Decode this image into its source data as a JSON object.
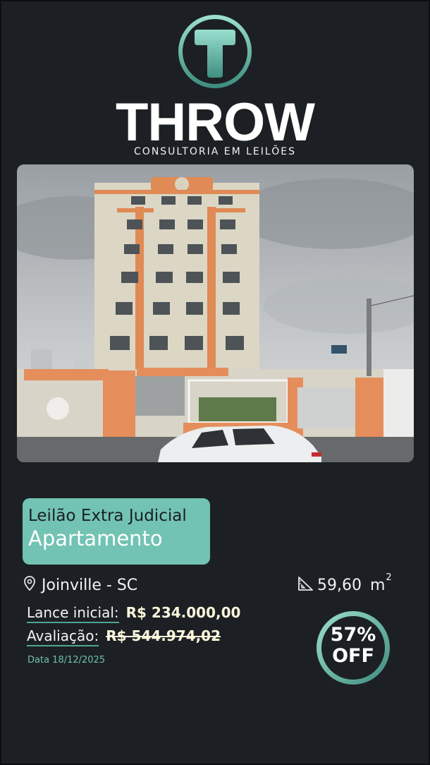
{
  "brand": {
    "name": "THROW",
    "tagline": "CONSULTORIA EM LEILÕES",
    "accent_color": "#72c3b3"
  },
  "listing": {
    "auction_type": "Leilão Extra Judicial",
    "property_type": "Apartamento",
    "location": "Joinville - SC",
    "area": "59,60",
    "area_unit": "m",
    "area_exp": "2",
    "initial_bid_label": "Lance inicial:",
    "initial_bid_value": "R$ 234.000,00",
    "appraisal_label": "Avaliação:",
    "appraisal_value": "R$ 544.974,02",
    "date": "Data 18/12/2025",
    "discount": "57%",
    "discount_suffix": "OFF"
  },
  "icons": {
    "location": "map-pin-icon",
    "area": "ruler-triangle-icon"
  }
}
